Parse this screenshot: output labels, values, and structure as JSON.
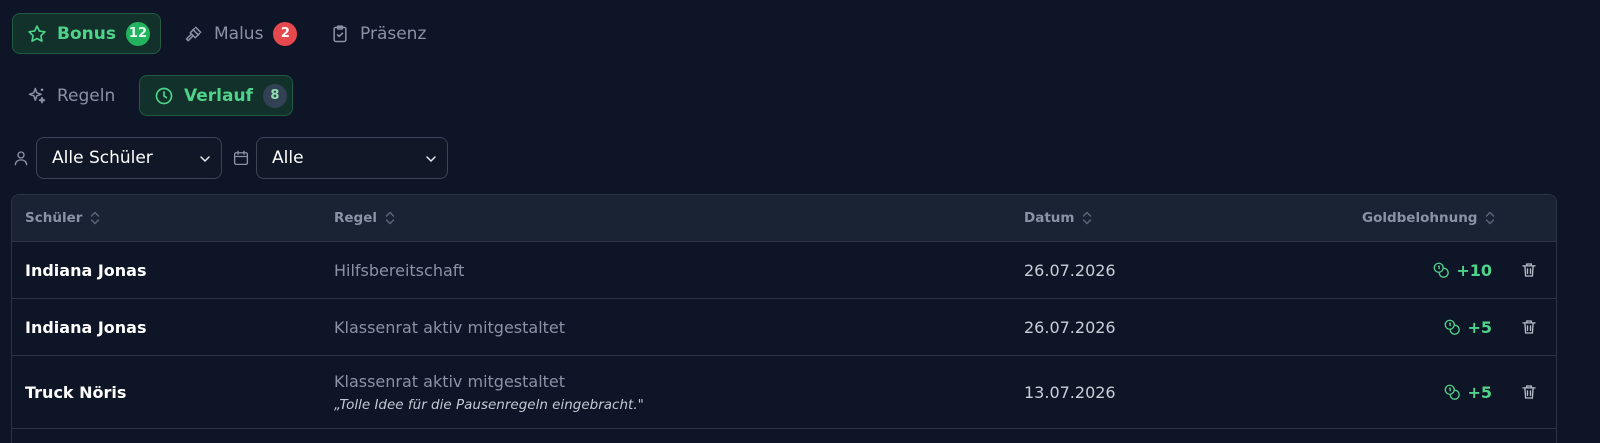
{
  "tabs_main": [
    {
      "label": "Bonus",
      "count": "12",
      "icon": "star-icon",
      "active": true
    },
    {
      "label": "Malus",
      "count": "2",
      "icon": "gavel-icon",
      "active": false
    },
    {
      "label": "Präsenz",
      "icon": "clipboard-check-icon",
      "active": false
    }
  ],
  "tabs_sub": [
    {
      "label": "Regeln",
      "icon": "sparkles-icon",
      "active": false
    },
    {
      "label": "Verlauf",
      "count": "8",
      "icon": "clock-icon",
      "active": true
    }
  ],
  "filters": {
    "student": {
      "icon": "user-icon",
      "value": "Alle Schüler"
    },
    "date": {
      "icon": "calendar-icon",
      "value": "Alle"
    }
  },
  "table": {
    "headers": [
      "Schüler",
      "Regel",
      "Datum",
      "Goldbelohnung"
    ],
    "rows": [
      {
        "student": "Indiana Jonas",
        "rule": "Hilfsbereitschaft",
        "note": "",
        "date": "26.07.2026",
        "gold": "+10"
      },
      {
        "student": "Indiana Jonas",
        "rule": "Klassenrat aktiv mitgestaltet",
        "note": "",
        "date": "26.07.2026",
        "gold": "+5"
      },
      {
        "student": "Truck Nöris",
        "rule": "Klassenrat aktiv mitgestaltet",
        "note": "„Tolle Idee für die Pausenregeln eingebracht.\"",
        "date": "13.07.2026",
        "gold": "+5"
      }
    ]
  },
  "colors": {
    "accent_green": "#4fd38a",
    "badge_red": "#e5484d",
    "background": "#0e1526"
  }
}
